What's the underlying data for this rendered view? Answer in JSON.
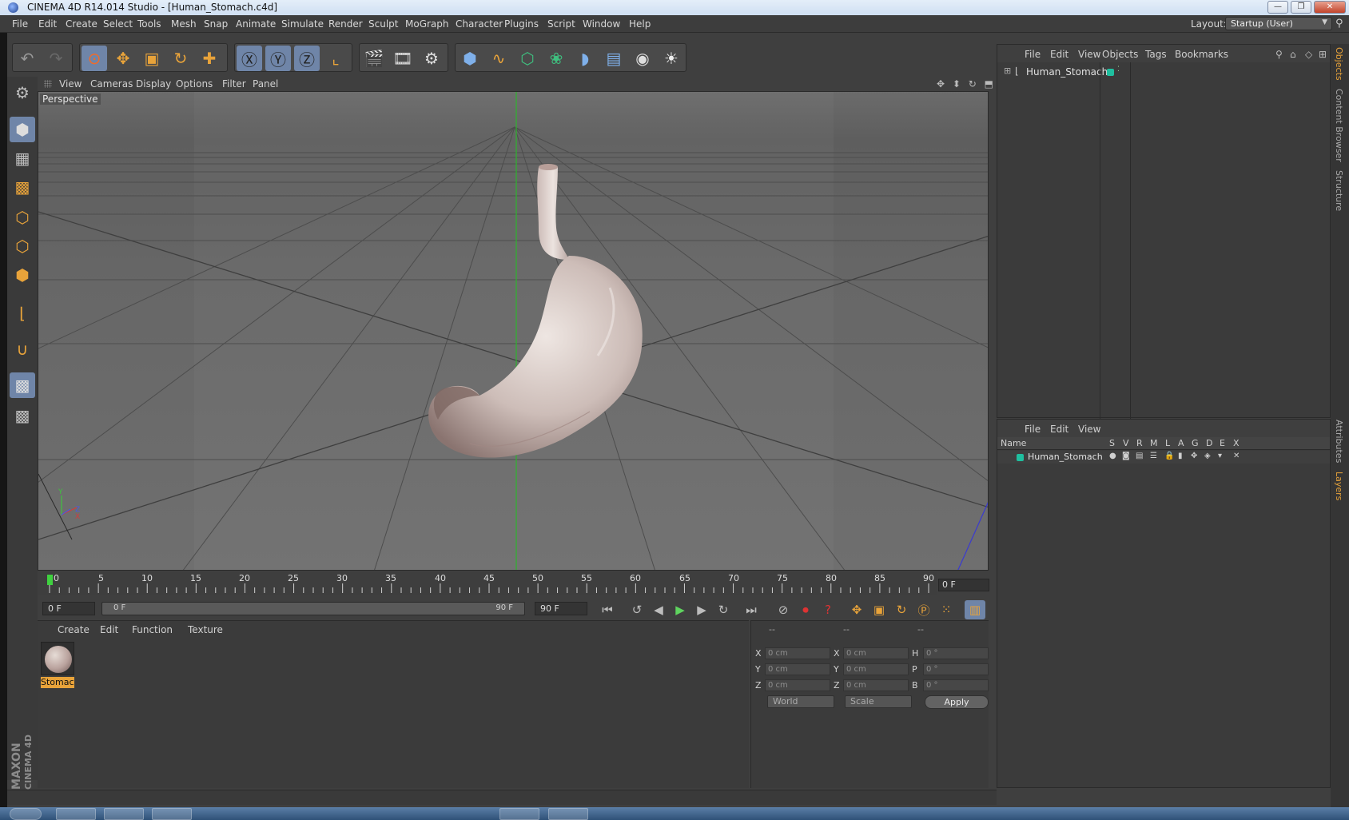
{
  "window": {
    "title": "CINEMA 4D R14.014 Studio - [Human_Stomach.c4d]",
    "min_glyph": "—",
    "max_glyph": "❐",
    "close_glyph": "✕"
  },
  "menubar": {
    "items": [
      "File",
      "Edit",
      "Create",
      "Select",
      "Tools",
      "Mesh",
      "Snap",
      "Animate",
      "Simulate",
      "Render",
      "Sculpt",
      "MoGraph",
      "Character",
      "Plugins",
      "Script",
      "Window",
      "Help"
    ],
    "layout_label": "Layout:",
    "layout_value": "Startup (User)"
  },
  "toolbar": {
    "icons": [
      "undo-icon",
      "redo-icon",
      "live-selection-icon",
      "move-icon",
      "scale-icon",
      "rotate-icon",
      "add-icon",
      "x-axis-lock-icon",
      "y-axis-lock-icon",
      "z-axis-lock-icon",
      "coordinate-system-icon",
      "render-view-icon",
      "render-picture-viewer-icon",
      "edit-render-settings-icon",
      "cube-primitive-icon",
      "spline-icon",
      "subdivision-surface-icon",
      "cloner-icon",
      "deformer-icon",
      "floor-icon",
      "camera-icon",
      "light-icon"
    ]
  },
  "lefttools": {
    "icons": [
      "make-editable-icon",
      "model-mode-icon",
      "texture-mode-icon",
      "workplane-icon",
      "points-mode-icon",
      "edges-mode-icon",
      "polygons-mode-icon",
      "axis-mode-icon",
      "snapping-icon",
      "locked-workplane-icon",
      "planar-workplane-icon"
    ]
  },
  "brand": {
    "line1": "MAXON",
    "line2": "CINEMA 4D"
  },
  "viewport": {
    "menu": [
      "View",
      "Cameras",
      "Display",
      "Options",
      "Filter",
      "Panel"
    ],
    "label": "Perspective",
    "nav_icons": "✥ ⬍ ↻ ⬒",
    "gizmo_y": "Y",
    "gizmo_x": "X",
    "gizmo_z": "Z"
  },
  "timeline": {
    "ticks": [
      "0",
      "5",
      "10",
      "15",
      "20",
      "25",
      "30",
      "35",
      "40",
      "45",
      "50",
      "55",
      "60",
      "65",
      "70",
      "75",
      "80",
      "85",
      "90"
    ],
    "current_frame": "0 F",
    "start_frame": "0 F",
    "slider_start": "0 F",
    "slider_end": "90 F",
    "end_frame": "90 F"
  },
  "material_manager": {
    "menu": [
      "Create",
      "Edit",
      "Function",
      "Texture"
    ],
    "material_name": "Stomach"
  },
  "coordinates": {
    "headers": [
      "--",
      "--",
      "--"
    ],
    "rows": [
      {
        "label_a": "X",
        "val_a": "0 cm",
        "label_b": "X",
        "val_b": "0 cm",
        "label_c": "H",
        "val_c": "0 °"
      },
      {
        "label_a": "Y",
        "val_a": "0 cm",
        "label_b": "Y",
        "val_b": "0 cm",
        "label_c": "P",
        "val_c": "0 °"
      },
      {
        "label_a": "Z",
        "val_a": "0 cm",
        "label_b": "Z",
        "val_b": "0 cm",
        "label_c": "B",
        "val_c": "0 °"
      }
    ],
    "space_value": "World",
    "mode_value": "Scale",
    "apply_label": "Apply"
  },
  "object_manager": {
    "menu": [
      "File",
      "Edit",
      "View",
      "Objects",
      "Tags",
      "Bookmarks"
    ],
    "object_name": "Human_Stomach"
  },
  "layer_manager": {
    "menu": [
      "File",
      "Edit",
      "View"
    ],
    "columns": [
      "Name",
      "S",
      "V",
      "R",
      "M",
      "L",
      "A",
      "G",
      "D",
      "E",
      "X"
    ],
    "layer_name": "Human_Stomach"
  },
  "side_tabs": [
    "Objects",
    "Content Browser",
    "Structure",
    "Attributes",
    "Layers"
  ],
  "colors": {
    "accent": "#e8a33a",
    "layer": "#1fbf9f",
    "active_tool": "#6f85a8",
    "play": "#5fd45f"
  }
}
